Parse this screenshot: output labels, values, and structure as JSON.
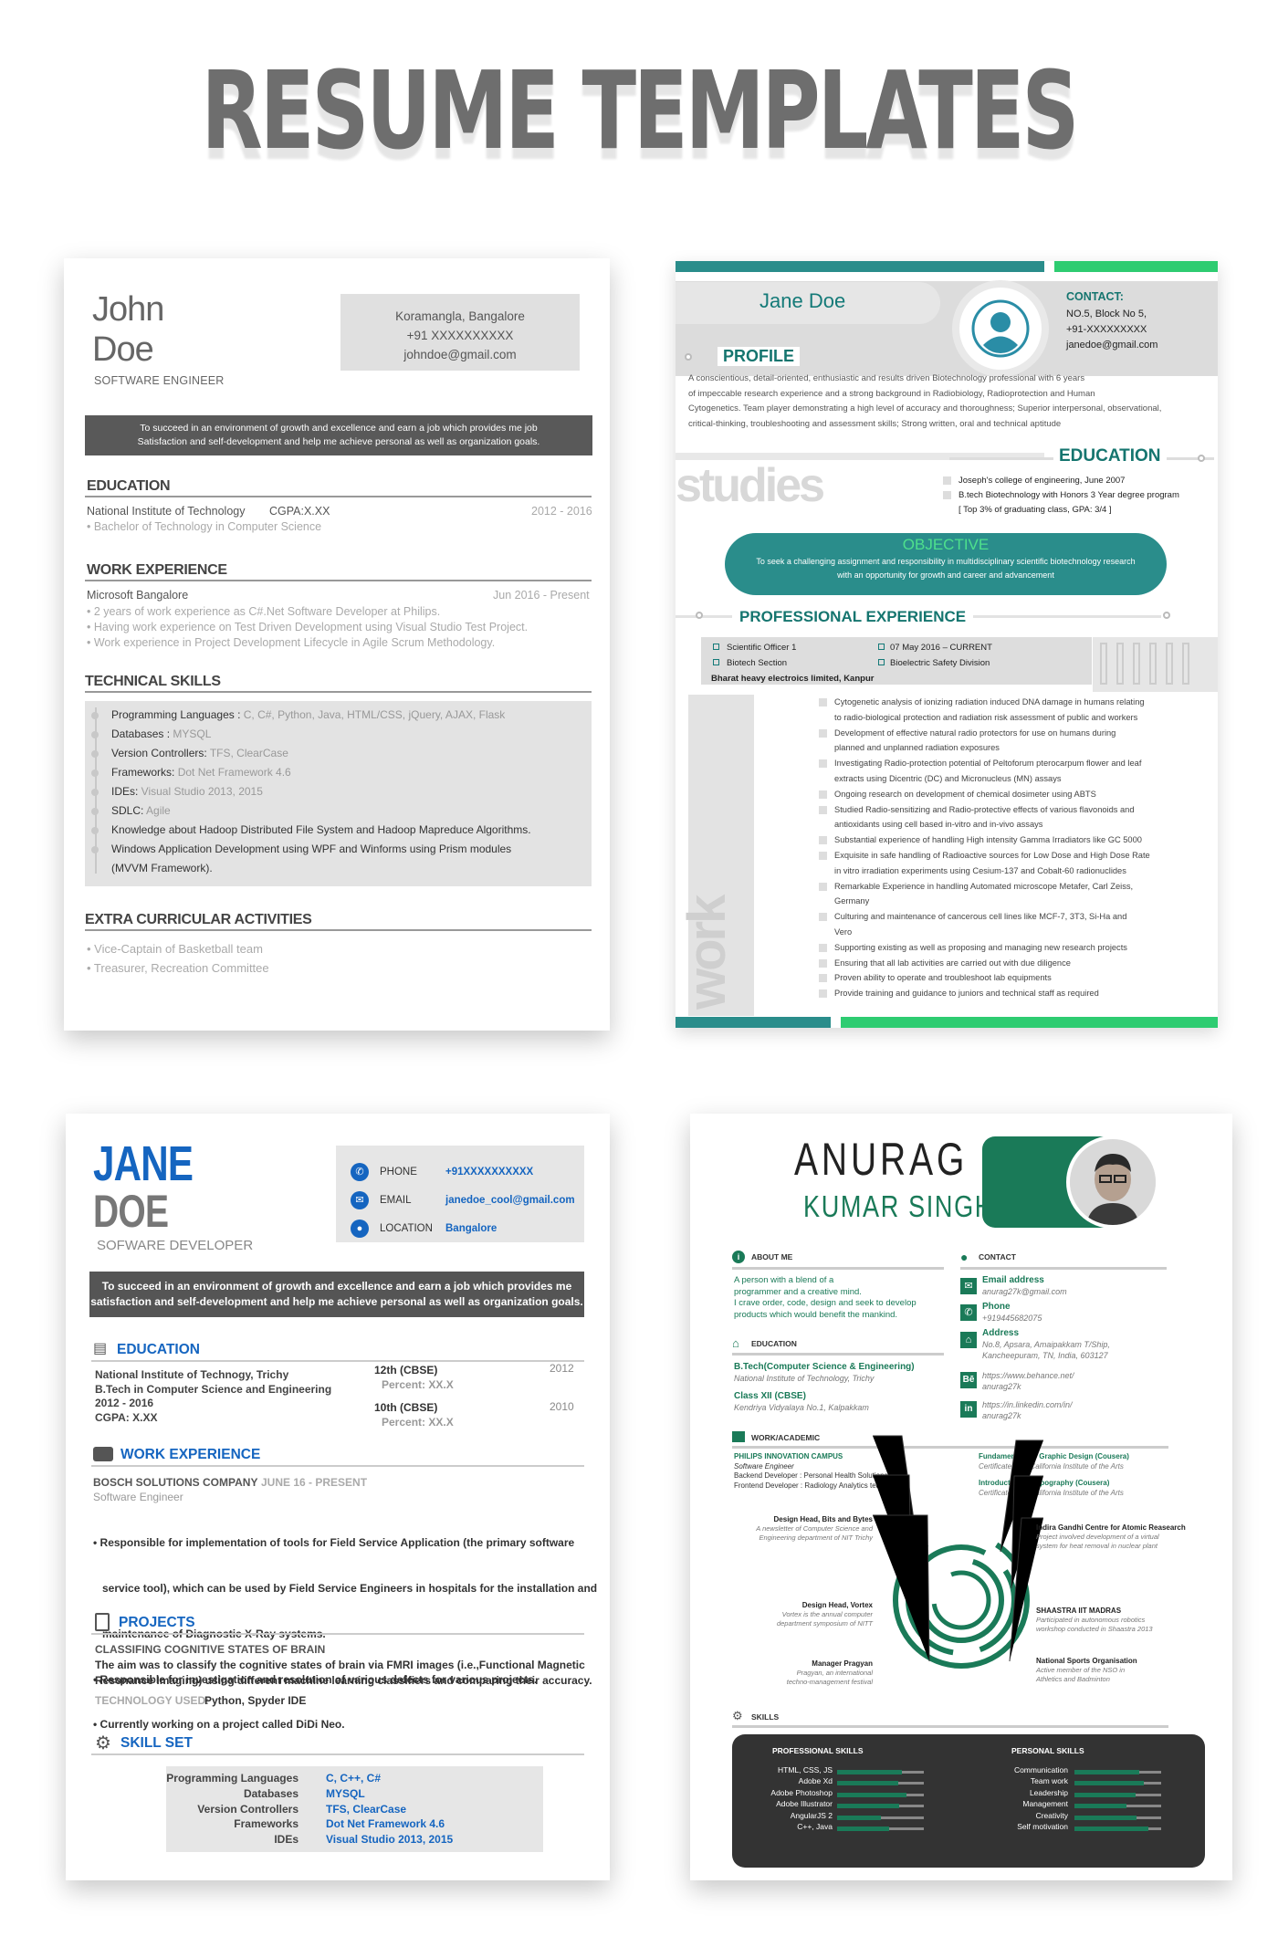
{
  "title": "RESUME TEMPLATES",
  "r1": {
    "first": "John",
    "last": "Doe",
    "role": "SOFTWARE ENGINEER",
    "contact": [
      "Koramangla, Bangalore",
      "+91 XXXXXXXXXX",
      "johndoe@gmail.com"
    ],
    "objective": [
      "To succeed in an environment of growth and excellence and earn a job which provides me job",
      "Satisfaction and self-development and help me achieve personal as well as organization goals."
    ],
    "edu_h": "EDUCATION",
    "edu_inst": "National Institute of Technology",
    "edu_cgpa": "CGPA:X.XX",
    "edu_years": "2012 - 2016",
    "edu_deg": "• Bachelor of Technology in Computer Science",
    "work_h": "WORK EXPERIENCE",
    "work_co": "Microsoft Bangalore",
    "work_dates": "Jun 2016 - Present",
    "work_items": [
      "• 2 years of work experience as C#.Net Software Developer at Philips.",
      "• Having work experience on Test Driven Development using Visual Studio Test Project.",
      "• Work experience in Project Development Lifecycle in Agile Scrum Methodology."
    ],
    "tech_h": "TECHNICAL SKILLS",
    "skills": [
      {
        "k": "Programming Languages : ",
        "v": "C, C#, Python, Java, HTML/CSS, jQuery, AJAX, Flask"
      },
      {
        "k": "Databases : ",
        "v": "MYSQL"
      },
      {
        "k": "Version Controllers: ",
        "v": "TFS, ClearCase"
      },
      {
        "k": "Frameworks: ",
        "v": "Dot Net Framework 4.6"
      },
      {
        "k": "IDEs: ",
        "v": "Visual Studio 2013, 2015"
      },
      {
        "k": "SDLC: ",
        "v": "Agile"
      },
      {
        "k": "Knowledge about Hadoop Distributed File System and Hadoop Mapreduce Algorithms.",
        "v": ""
      },
      {
        "k": "Windows Application Development using WPF and Winforms using Prism modules",
        "v": ""
      },
      {
        "k": "(MVVM Framework).",
        "v": ""
      }
    ],
    "extra_h": "EXTRA CURRICULAR ACTIVITIES",
    "extra": [
      "• Vice-Captain of Basketball team",
      "• Treasurer, Recreation Committee"
    ]
  },
  "r2": {
    "name": "Jane Doe",
    "contact_h": "CONTACT:",
    "contact": [
      "NO.5, Block No 5,",
      "+91-XXXXXXXXX",
      "janedoe@gmail.com"
    ],
    "profile_h": "PROFILE",
    "profile": [
      "A conscientious, detail-oriented, enthusiastic and results driven Biotechnology professional with 6 years",
      "of impeccable research experience and a strong background in Radiobiology, Radioprotection and Human",
      "Cytogenetics. Team player demonstrating a high level of accuracy and thoroughness; Superior interpersonal, observational,",
      "critical-thinking, troubleshooting and assessment skills; Strong written, oral and technical aptitude"
    ],
    "studies": "studies",
    "edu_h": "EDUCATION",
    "edu": [
      "Joseph's college of engineering, June 2007",
      "B.tech Biotechnology with Honors 3 Year degree program"
    ],
    "edu_note": "[ Top 3% of graduating class, GPA: 3/4 ]",
    "obj_h": "OBJECTIVE",
    "obj": [
      "To seek a challenging assignment and responsibility in multidisciplinary scientific biotechnology research",
      "with an opportunity for growth and career and advancement"
    ],
    "pe_h": "PROFESSIONAL EXPERIENCE",
    "pe": [
      "Scientific Officer 1",
      "07 May 2016 – CURRENT",
      "Biotech  Section",
      "Bioelectric Safety Division",
      "Bharat heavy electroics limited, Kanpur"
    ],
    "work": "work",
    "bullets": [
      "Cytogenetic analysis of ionizing radiation induced DNA damage in humans relating",
      "to radio-biological protection and radiation risk assessment of public and workers",
      "Development of effective natural radio protectors for use on humans during",
      "planned and unplanned radiation exposures",
      "Investigating Radio-protection potential of Peltoforum pterocarpum flower and leaf",
      "extracts using Dicentric (DC) and Micronucleus (MN) assays",
      "Ongoing research on development of chemical dosimeter using ABTS",
      "Studied Radio-sensitizing and Radio-protective effects of various flavonoids and",
      "antioxidants using cell based in-vitro and in-vivo assays",
      "Substantial experience of handling High intensity Gamma Irradiators like GC 5000",
      "Exquisite in safe handling of Radioactive sources for Low Dose and High Dose Rate",
      "in vitro irradiation experiments using Cesium-137 and Cobalt-60 radionuclides",
      "Remarkable Experience in handling Automated microscope Metafer, Carl Zeiss,",
      "Germany",
      "Culturing and maintenance of cancerous cell lines like MCF-7, 3T3, Si-Ha and",
      "Vero",
      "Supporting existing as well as proposing and managing new research projects",
      "Ensuring that all lab activities are carried out with due diligence",
      "Proven ability to operate and troubleshoot lab equipments",
      "Provide training and guidance to juniors and technical staff as required"
    ]
  },
  "r3": {
    "first": "JANE",
    "last": "DOE",
    "role": "SOFWARE DEVELOPER",
    "contact": [
      {
        "k": "PHONE",
        "v": "+91XXXXXXXXXX"
      },
      {
        "k": "EMAIL",
        "v": "janedoe_cool@gmail.com"
      },
      {
        "k": "LOCATION",
        "v": "Bangalore"
      }
    ],
    "objective": [
      "To succeed in an environment of growth and excellence and earn a job which provides me",
      "satisfaction and self-development and help me achieve personal as well as organization goals."
    ],
    "edu_h": "EDUCATION",
    "edu_l": [
      "National Institute of Technogy, Trichy",
      "B.Tech in Computer Science and Engineering",
      "2012 - 2016",
      "CGPA: X.XX"
    ],
    "edu_r": [
      {
        "a": "12th (CBSE)",
        "b": "Percent: XX.X",
        "y": "2012"
      },
      {
        "a": "10th (CBSE)",
        "b": "Percent: XX.X",
        "y": "2010"
      }
    ],
    "work_h": "WORK EXPERIENCE",
    "work_co": "BOSCH SOLUTIONS COMPANY",
    "work_dates": "JUNE 16 - PRESENT",
    "work_role": "Software Engineer",
    "work_items": [
      "• Responsible for implementation of tools for Field Service Application (the primary software",
      "   service tool), which can be used by Field Service Engineers in hospitals for the installation and",
      "   maintenance of Diagnostic X-Ray systems.",
      "• Responsible for investigation and resolution of various defects for various projects.",
      "• Currently working on a project called DiDi Neo."
    ],
    "proj_h": "PROJECTS",
    "proj_t": "CLASSIFING COGNITIVE STATES OF BRAIN",
    "proj_d": [
      "The aim was to classify the cognitive states of brain via FMRI images (i.e.,Functional Magnetic",
      "Resonance Imaging) using different machine learning classifiers and comparing their accuracy."
    ],
    "proj_tech_k": "TECHNOLOGY USED:",
    "proj_tech_v": "Python, Spyder IDE",
    "skill_h": "SKILL SET",
    "skills": [
      {
        "k": "Programming Languages",
        "v": "C, C++, C#"
      },
      {
        "k": "Databases",
        "v": "MYSQL"
      },
      {
        "k": "Version Controllers",
        "v": "TFS, ClearCase"
      },
      {
        "k": "Frameworks",
        "v": "Dot Net Framework 4.6"
      },
      {
        "k": "IDEs",
        "v": "Visual Studio 2013, 2015"
      }
    ]
  },
  "r4": {
    "first": "ANURAG",
    "last": "KUMAR SINGH",
    "about_h": "ABOUT ME",
    "about": [
      "A person with a blend of a",
      "programmer and a creative mind.",
      "I crave order, code, design and seek to develop",
      "products which would benefit the mankind."
    ],
    "edu_h": "EDUCATION",
    "edu": [
      {
        "a": "B.Tech(Computer Science & Engineering)",
        "b": "National Institute of Technology, Trichy"
      },
      {
        "a": "Class XII (CBSE)",
        "b": "Kendriya Vidyalaya No.1, Kalpakkam"
      }
    ],
    "contact_h": "CONTACT",
    "contact": [
      {
        "k": "Email address",
        "v": [
          "anurag27k@gmail.com"
        ]
      },
      {
        "k": "Phone",
        "v": [
          "+919445682075"
        ]
      },
      {
        "k": "Address",
        "v": [
          "No.8, Apsara, Amaipakkam T/Ship,",
          "Kancheepuram, TN, India, 603127"
        ]
      },
      {
        "k": "",
        "v": [
          "https://www.behance.net/",
          "anurag27k"
        ]
      },
      {
        "k": "",
        "v": [
          "https://in.linkedin.com/in/",
          "anurag27k"
        ]
      }
    ],
    "work_h": "WORK/ACADEMIC",
    "w1": "PHILIPS INNOVATION CAMPUS",
    "w2": [
      "Software Engineer",
      "Backend Developer : Personal Health Solutions team",
      "Frontend Developer : Radiology Analytics team"
    ],
    "c1": "Fundamentals of Graphic Design (Cousera)",
    "c1d": "Certificate  from California Institute of the Arts",
    "c2": "Introduction to Typography (Cousera)",
    "c2d": "Certificate from California Institute of the Arts",
    "tl": [
      {
        "t": "Design Head, Bits and Bytes",
        "d": [
          "A newsletter of Computer Science and",
          "Engineering department of NIT Trichy"
        ]
      },
      {
        "t": "Design Head, Vortex",
        "d": [
          "Vortex is the annual computer",
          "department symposium of NITT"
        ]
      },
      {
        "t": "Manager Pragyan",
        "d": [
          "Pragyan, an international",
          "techno-management festival"
        ]
      }
    ],
    "tr": [
      {
        "t": "Indira Gandhi Centre for Atomic Reasearch",
        "d": [
          "Project involved development of a virtual",
          "system for heat removal in nuclear plant"
        ]
      },
      {
        "t": "SHAASTRA IIT MADRAS",
        "d": [
          "Participated in autonomous robotics",
          "workshop conducted in Shaastra 2013"
        ]
      },
      {
        "t": "National Sports Organisation",
        "d": [
          "Active member of the NSO in",
          "Athletics and Badminton"
        ]
      }
    ],
    "skills_h": "SKILLS",
    "pro_h": "PROFESSIONAL SKILLS",
    "per_h": "PERSONAL SKILLS",
    "pro": [
      {
        "k": "HTML, CSS, JS",
        "v": 0.75
      },
      {
        "k": "Adobe Xd",
        "v": 0.7
      },
      {
        "k": "Adobe Photoshop",
        "v": 0.8
      },
      {
        "k": "Adobe Illustrator",
        "v": 0.72
      },
      {
        "k": "AngularJS 2",
        "v": 0.5
      },
      {
        "k": "C++, Java",
        "v": 0.6
      }
    ],
    "per": [
      {
        "k": "Communication",
        "v": 0.75
      },
      {
        "k": "Team work",
        "v": 0.8
      },
      {
        "k": "Leadership",
        "v": 0.7
      },
      {
        "k": "Management",
        "v": 0.6
      },
      {
        "k": "Creativity",
        "v": 0.72
      },
      {
        "k": "Self motivation",
        "v": 0.85
      }
    ],
    "colors": {
      "green": "#1a7a58",
      "dark": "#333333"
    }
  }
}
